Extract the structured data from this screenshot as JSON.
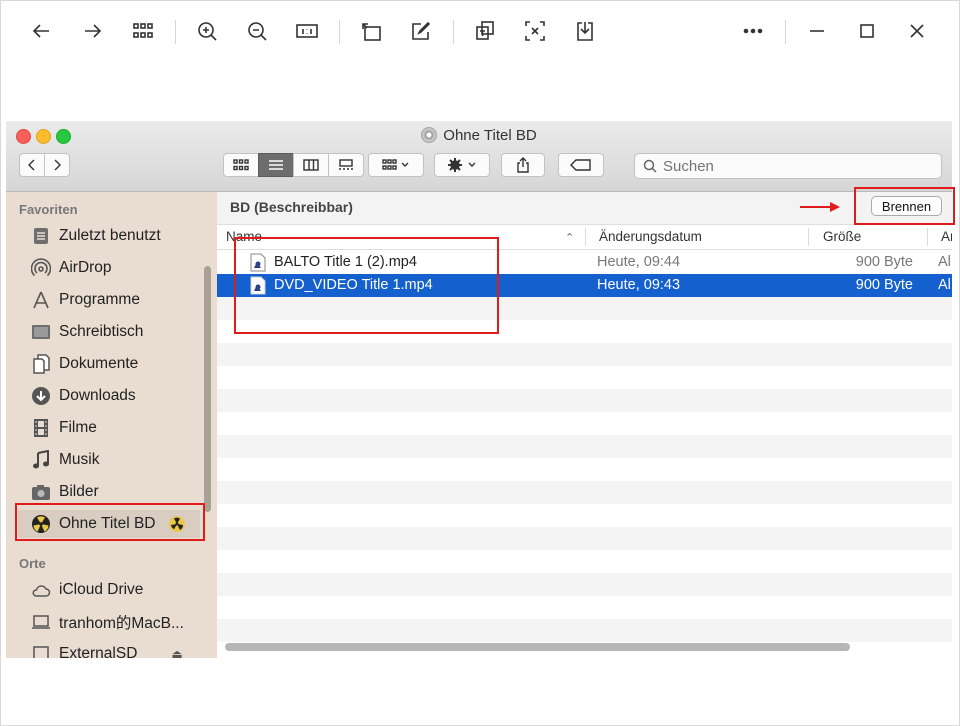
{
  "viewer": {
    "tools": [
      "back-arrow-icon",
      "forward-arrow-icon",
      "grid-icon",
      "zoom-in-icon",
      "zoom-out-icon",
      "actual-size-icon",
      "rotate-icon",
      "edit-icon",
      "translate-icon",
      "text-extract-icon",
      "download-icon",
      "more-icon",
      "minimize-icon",
      "maximize-icon",
      "close-icon"
    ]
  },
  "window": {
    "title": "Ohne Titel BD",
    "search_placeholder": "Suchen"
  },
  "sidebar": {
    "section_favorites": "Favoriten",
    "favorites": [
      {
        "label": "Zuletzt benutzt",
        "icon": "recents-icon"
      },
      {
        "label": "AirDrop",
        "icon": "airdrop-icon"
      },
      {
        "label": "Programme",
        "icon": "applications-icon"
      },
      {
        "label": "Schreibtisch",
        "icon": "desktop-icon"
      },
      {
        "label": "Dokumente",
        "icon": "documents-icon"
      },
      {
        "label": "Downloads",
        "icon": "downloads-icon"
      },
      {
        "label": "Filme",
        "icon": "movies-icon"
      },
      {
        "label": "Musik",
        "icon": "music-icon"
      },
      {
        "label": "Bilder",
        "icon": "pictures-icon"
      },
      {
        "label": "Ohne Titel BD",
        "icon": "burn-disc-icon"
      }
    ],
    "section_places": "Orte",
    "places": [
      {
        "label": "iCloud Drive",
        "icon": "cloud-icon"
      },
      {
        "label": "tranhom的MacB...",
        "icon": "laptop-icon"
      },
      {
        "label": "ExternalSD",
        "icon": "drive-icon"
      }
    ]
  },
  "content": {
    "path_label": "BD (Beschreibbar)",
    "burn_button": "Brennen",
    "columns": [
      "Name",
      "Änderungsdatum",
      "Größe",
      "Ar"
    ],
    "files": [
      {
        "name": "BALTO Title 1 (2).mp4",
        "date": "Heute, 09:44",
        "size": "900 Byte",
        "kind": "Al"
      },
      {
        "name": "DVD_VIDEO Title 1.mp4",
        "date": "Heute, 09:43",
        "size": "900 Byte",
        "kind": "Al"
      }
    ]
  },
  "colors": {
    "selection": "#1560cf",
    "annotation": "#e01b1b",
    "sidebar": "#e9ddd2"
  }
}
